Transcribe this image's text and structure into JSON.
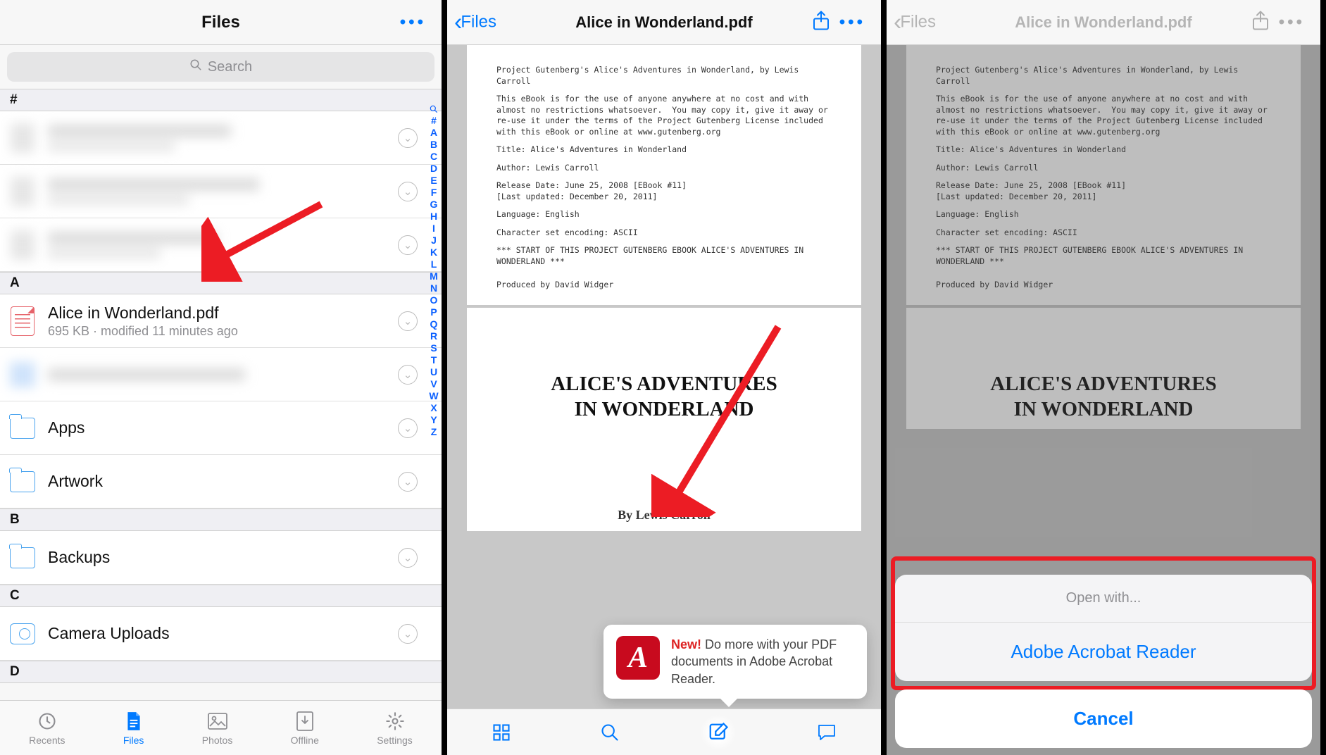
{
  "panel1": {
    "title": "Files",
    "search_placeholder": "Search",
    "sections": {
      "hash": "#",
      "a": "A",
      "b": "B",
      "c": "C",
      "d": "D"
    },
    "file_row": {
      "name": "Alice in Wonderland.pdf",
      "meta": "695 KB · modified 11 minutes ago"
    },
    "folders": {
      "apps": "Apps",
      "artwork": "Artwork",
      "backups": "Backups",
      "camera": "Camera Uploads"
    },
    "index": [
      "#",
      "A",
      "B",
      "C",
      "D",
      "E",
      "F",
      "G",
      "H",
      "I",
      "J",
      "K",
      "L",
      "M",
      "N",
      "O",
      "P",
      "Q",
      "R",
      "S",
      "T",
      "U",
      "V",
      "W",
      "X",
      "Y",
      "Z"
    ],
    "tabs": {
      "recents": "Recents",
      "files": "Files",
      "photos": "Photos",
      "offline": "Offline",
      "settings": "Settings"
    }
  },
  "viewer": {
    "back_label": "Files",
    "title": "Alice in Wonderland.pdf",
    "page_text": {
      "l1": "Project Gutenberg's Alice's Adventures in Wonderland, by Lewis Carroll",
      "l2": "This eBook is for the use of anyone anywhere at no cost and with almost no restrictions whatsoever.  You may copy it, give it away or re-use it under the terms of the Project Gutenberg License included with this eBook or online at www.gutenberg.org",
      "l3": "Title: Alice's Adventures in Wonderland",
      "l4": "Author: Lewis Carroll",
      "l5": "Release Date: June 25, 2008 [EBook #11]\n[Last updated: December 20, 2011]",
      "l6": "Language: English",
      "l7": "Character set encoding: ASCII",
      "l8": "*** START OF THIS PROJECT GUTENBERG EBOOK ALICE'S ADVENTURES IN WONDERLAND ***",
      "l9": "Produced by David Widger"
    },
    "doc_title_1": "ALICE'S ADVENTURES",
    "doc_title_2": "IN WONDERLAND",
    "byline": "By Lewis Carroll"
  },
  "tooltip": {
    "new": "New!",
    "body": " Do more with your PDF documents in Adobe Acrobat Reader."
  },
  "sheet": {
    "open_with": "Open with...",
    "adobe": "Adobe Acrobat Reader",
    "cancel": "Cancel"
  }
}
